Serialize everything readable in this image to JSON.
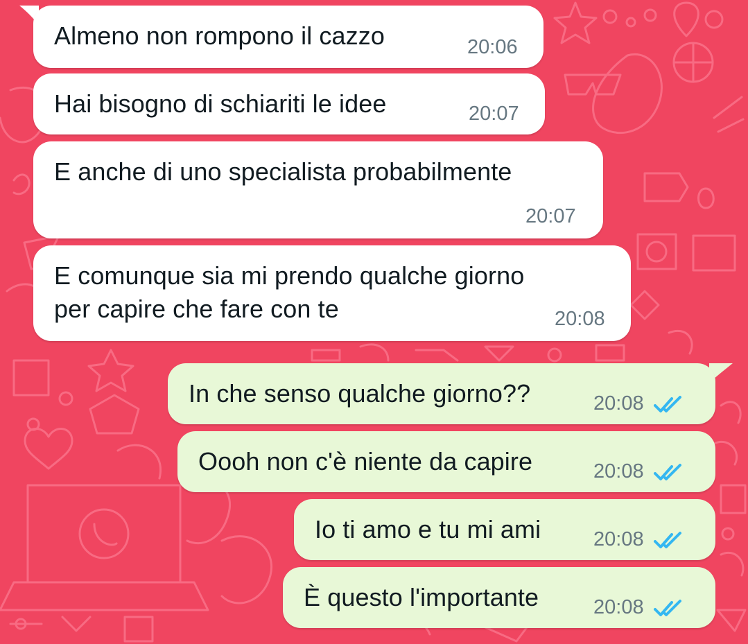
{
  "theme": {
    "wallpaper_color": "#f04560",
    "incoming_bubble_color": "#ffffff",
    "outgoing_bubble_color": "#e8f8d7",
    "time_color": "#667781",
    "read_tick_color": "#34b7f1"
  },
  "messages": [
    {
      "direction": "incoming",
      "text": "Almeno non rompono il cazzo",
      "time": "20:06",
      "read_receipt": null
    },
    {
      "direction": "incoming",
      "text": "Hai bisogno di schiariti le idee",
      "time": "20:07",
      "read_receipt": null
    },
    {
      "direction": "incoming",
      "text": "E anche di uno specialista probabilmente",
      "time": "20:07",
      "read_receipt": null
    },
    {
      "direction": "incoming",
      "text_lines": [
        "E comunque sia mi prendo qualche giorno",
        "per capire che fare con te"
      ],
      "time": "20:08",
      "read_receipt": null
    },
    {
      "direction": "outgoing",
      "text": "In che senso qualche giorno??",
      "time": "20:08",
      "read_receipt": "double-check-read-icon"
    },
    {
      "direction": "outgoing",
      "text": "Oooh non c'è niente da capire",
      "time": "20:08",
      "read_receipt": "double-check-read-icon"
    },
    {
      "direction": "outgoing",
      "text": "Io ti amo e tu mi ami",
      "time": "20:08",
      "read_receipt": "double-check-read-icon"
    },
    {
      "direction": "outgoing",
      "text": "È questo l'importante",
      "time": "20:08",
      "read_receipt": "double-check-read-icon"
    }
  ]
}
